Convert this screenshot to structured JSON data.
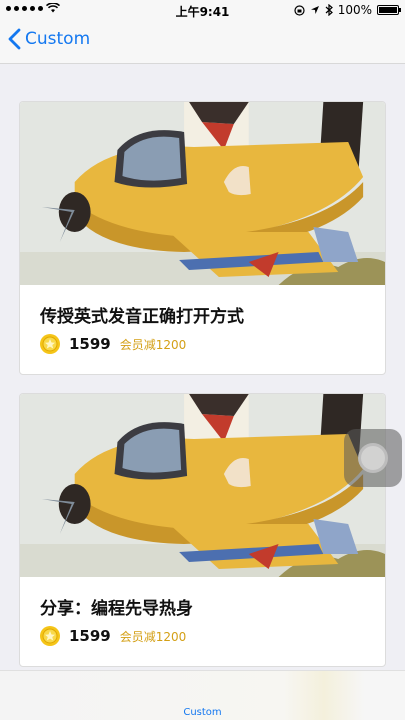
{
  "status_bar": {
    "carrier": "",
    "time": "上午9:41",
    "battery": "100%",
    "battery_level": 1.0
  },
  "nav": {
    "back_label": "Custom",
    "accent": "#1478f0"
  },
  "cards": [
    {
      "title": "传授英式发音正确打开方式",
      "price": "1599",
      "discount": "会员减1200",
      "image": "airplane-girl-illustration"
    },
    {
      "title": "分享：编程先导热身",
      "price": "1599",
      "discount": "会员减1200",
      "image": "airplane-girl-illustration"
    }
  ],
  "tab_bar": {
    "label": "Custom"
  },
  "colors": {
    "coin": "#f5c518",
    "discount": "#d4a017",
    "plane": "#e8b73e"
  }
}
